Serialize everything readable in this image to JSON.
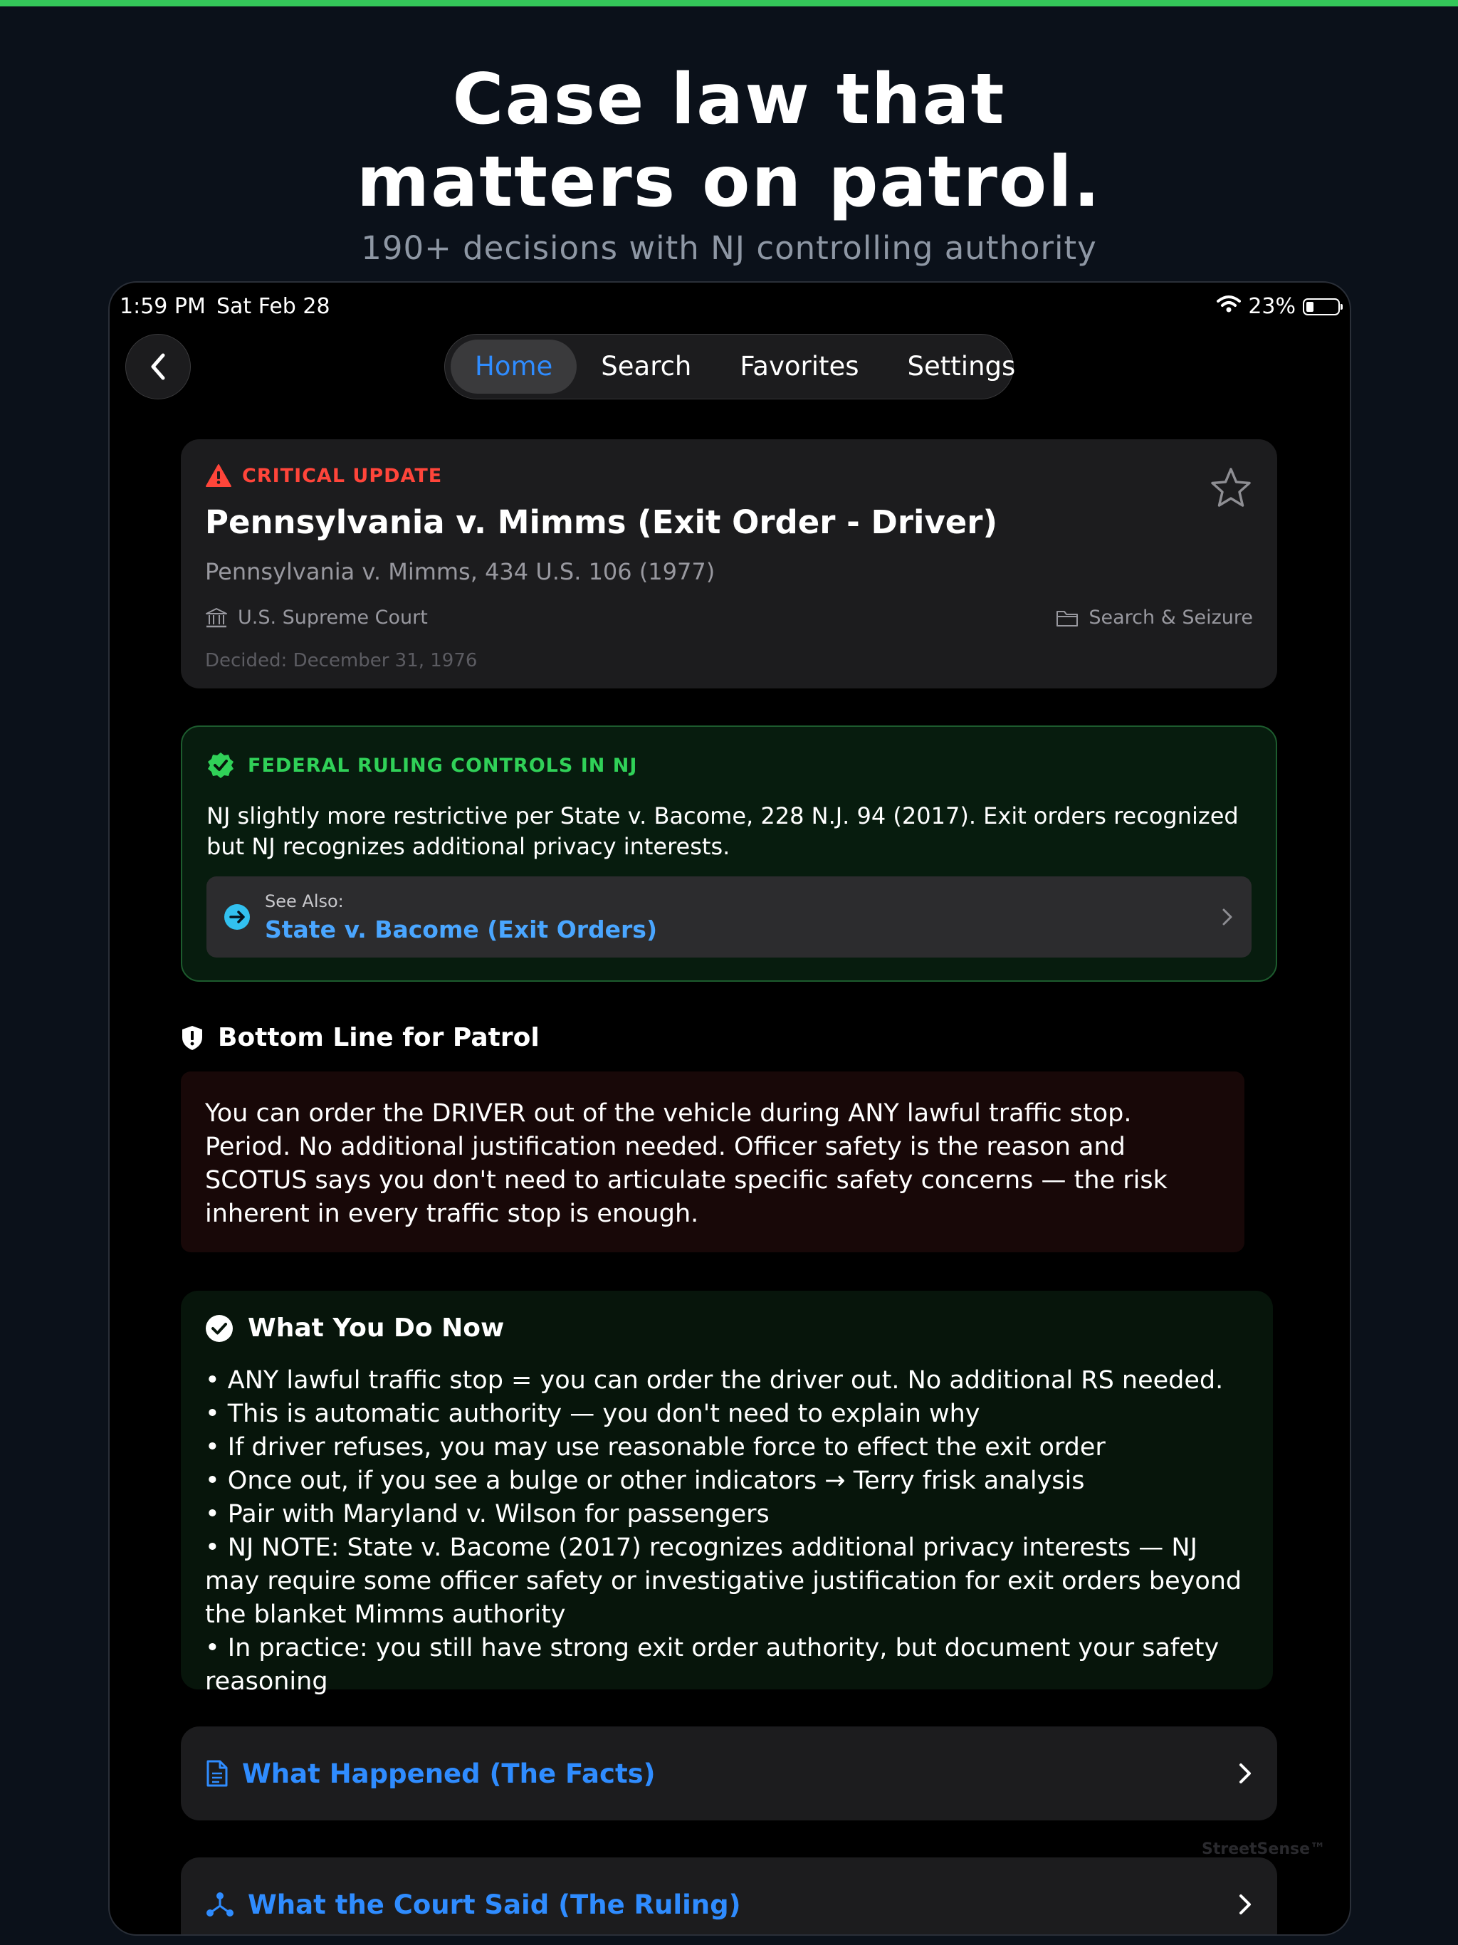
{
  "headline": {
    "line1": "Case law that",
    "line2": "matters on patrol."
  },
  "subheadline": "190+ decisions with NJ controlling authority",
  "status_bar": {
    "time": "1:59 PM",
    "date": "Sat Feb 28",
    "battery": "23%",
    "battery_level": 0.23
  },
  "nav": {
    "tabs": [
      {
        "label": "Home",
        "active": true
      },
      {
        "label": "Search",
        "active": false
      },
      {
        "label": "Favorites",
        "active": false
      },
      {
        "label": "Settings",
        "active": false
      }
    ]
  },
  "case": {
    "alert": "CRITICAL UPDATE",
    "title": "Pennsylvania v. Mimms (Exit Order - Driver)",
    "citation": "Pennsylvania v. Mimms, 434 U.S. 106 (1977)",
    "court": "U.S. Supreme Court",
    "category": "Search & Seizure",
    "decided": "Decided: December 31, 1976"
  },
  "controlling": {
    "label": "FEDERAL RULING CONTROLS IN NJ",
    "text": "NJ slightly more restrictive per State v. Bacome, 228 N.J. 94 (2017). Exit orders recognized but NJ recognizes additional privacy interests.",
    "see_also_label": "See Also:",
    "see_also_link": "State v. Bacome (Exit Orders)"
  },
  "bottom_line": {
    "heading": "Bottom Line for Patrol",
    "text": "You can order the DRIVER out of the vehicle during ANY lawful traffic stop. Period. No additional justification needed. Officer safety is the reason and SCOTUS says you don't need to articulate specific safety concerns — the risk inherent in every traffic stop is enough."
  },
  "what_you_do": {
    "heading": "What You Do Now",
    "bullets": [
      "• ANY lawful traffic stop = you can order the driver out. No additional RS needed.",
      "• This is automatic authority — you don't need to explain why",
      "• If driver refuses, you may use reasonable force to effect the exit order",
      "• Once out, if you see a bulge or other indicators → Terry frisk analysis",
      "• Pair with Maryland v. Wilson for passengers",
      "• NJ NOTE: State v. Bacome (2017) recognizes additional privacy interests — NJ may require some officer safety or investigative justification for exit orders beyond the blanket Mimms authority",
      "• In practice: you still have strong exit order authority, but document your safety reasoning"
    ]
  },
  "sections": [
    {
      "label": "What Happened (The Facts)"
    },
    {
      "label": "What the Court Said (The Ruling)"
    }
  ],
  "watermark": "StreetSense™",
  "colors": {
    "accent": "#2f8cff",
    "critical": "#ff453a",
    "success": "#30d158",
    "topbar": "#34c759"
  }
}
